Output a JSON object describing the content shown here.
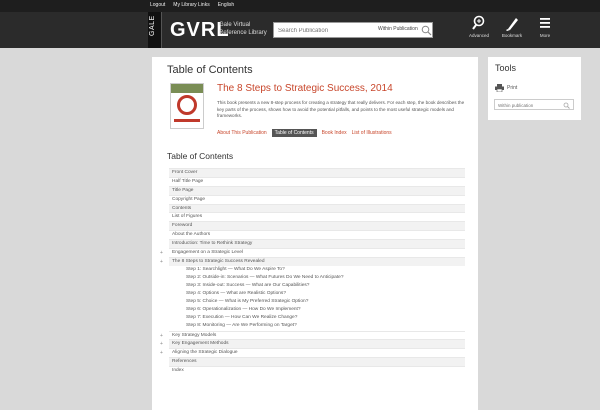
{
  "util_links": [
    "Logout",
    "My Library Links",
    "English"
  ],
  "header": {
    "gale_label": "GALE",
    "brand": "GVRL",
    "brand_sub": "Gale Virtual Reference Library",
    "search_placeholder": "Search Publication",
    "search_scope": "Within Publication",
    "tools": [
      {
        "label": "Advanced",
        "icon": "advanced-search-icon"
      },
      {
        "label": "Bookmark",
        "icon": "bookmark-icon"
      },
      {
        "label": "More",
        "icon": "hamburger-menu-icon"
      }
    ]
  },
  "main": {
    "heading": "Table of Contents",
    "book": {
      "title": "The 8 Steps to Strategic Success, 2014",
      "description": "This book presents a new 8-step process for creating a strategy that really delivers. For each step, the book describes the key parts of the process, shows how to avoid the potential pitfalls, and points to the most useful strategic models and frameworks.",
      "nav": [
        "About This Publication",
        "Table of Contents",
        "Book Index",
        "List of Illustrations"
      ],
      "active_nav": "Table of Contents"
    },
    "toc_subheading": "Table of Contents",
    "toc": [
      {
        "text": "Front Cover",
        "level": 1,
        "expandable": false
      },
      {
        "text": "Half Title Page",
        "level": 1,
        "expandable": false
      },
      {
        "text": "Title Page",
        "level": 1,
        "expandable": false
      },
      {
        "text": "Copyright Page",
        "level": 1,
        "expandable": false
      },
      {
        "text": "Contents",
        "level": 1,
        "expandable": false
      },
      {
        "text": "List of Figures",
        "level": 1,
        "expandable": false
      },
      {
        "text": "Foreword",
        "level": 1,
        "expandable": false
      },
      {
        "text": "About the Authors",
        "level": 1,
        "expandable": false
      },
      {
        "text": "Introduction: Time to Rethink Strategy",
        "level": 1,
        "expandable": false
      },
      {
        "text": "Engagement on a Strategic Level",
        "level": 1,
        "expandable": true
      },
      {
        "text": "The 8 Steps to Strategic Success Revealed",
        "level": 1,
        "expandable": true
      },
      {
        "text": "Step 1: Searchlight — What Do We Aspire To?",
        "level": 2,
        "expandable": false
      },
      {
        "text": "Step 2: Outside-in: Scenarios — What Futures Do We Need to Anticipate?",
        "level": 2,
        "expandable": false
      },
      {
        "text": "Step 3: Inside-out: Success — What are Our Capabilities?",
        "level": 2,
        "expandable": false
      },
      {
        "text": "Step 4: Options — What are Realistic Options?",
        "level": 2,
        "expandable": false
      },
      {
        "text": "Step 5: Choice — What is My Preferred Strategic Option?",
        "level": 2,
        "expandable": false
      },
      {
        "text": "Step 6: Operationalization — How Do We Implement?",
        "level": 2,
        "expandable": false
      },
      {
        "text": "Step 7: Execution — How Can We Realize Change?",
        "level": 2,
        "expandable": false
      },
      {
        "text": "Step 8: Monitoring — Are We Performing on Target?",
        "level": 2,
        "expandable": false
      },
      {
        "text": "Key Strategy Models",
        "level": 1,
        "expandable": true
      },
      {
        "text": "Key Engagement Methods",
        "level": 1,
        "expandable": true
      },
      {
        "text": "Aligning the Strategic Dialogue",
        "level": 1,
        "expandable": true
      },
      {
        "text": "References",
        "level": 1,
        "expandable": false
      },
      {
        "text": "Index",
        "level": 1,
        "expandable": false
      }
    ]
  },
  "tools_panel": {
    "title": "Tools",
    "print_label": "Print",
    "search_placeholder": "Within publication"
  },
  "colors": {
    "accent": "#c8462b",
    "header_bg": "#2b2b2b",
    "page_bg": "#d9d9d9"
  }
}
